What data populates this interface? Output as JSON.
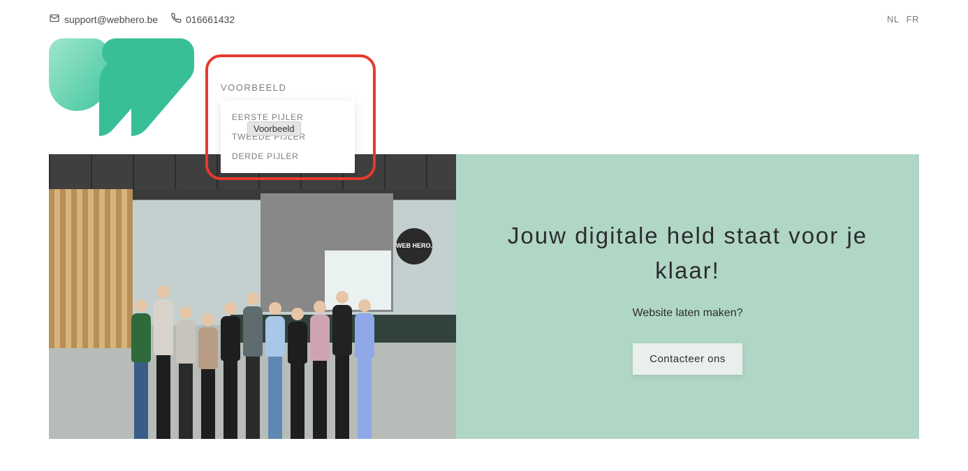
{
  "topbar": {
    "email": "support@webhero.be",
    "phone": "016661432",
    "lang_nl": "NL",
    "lang_fr": "FR"
  },
  "nav": {
    "top_item": "VOORBEELD",
    "dropdown": {
      "items": [
        {
          "label": "EERSTE PIJLER"
        },
        {
          "label": "TWEEDE PIJLER"
        },
        {
          "label": "DERDE PIJLER"
        }
      ]
    },
    "tooltip": "Voorbeeld"
  },
  "hero": {
    "headline": "Jouw digitale held staat voor je klaar!",
    "subline": "Website laten maken?",
    "cta": "Contacteer ons",
    "badge": "WEB HERO."
  }
}
